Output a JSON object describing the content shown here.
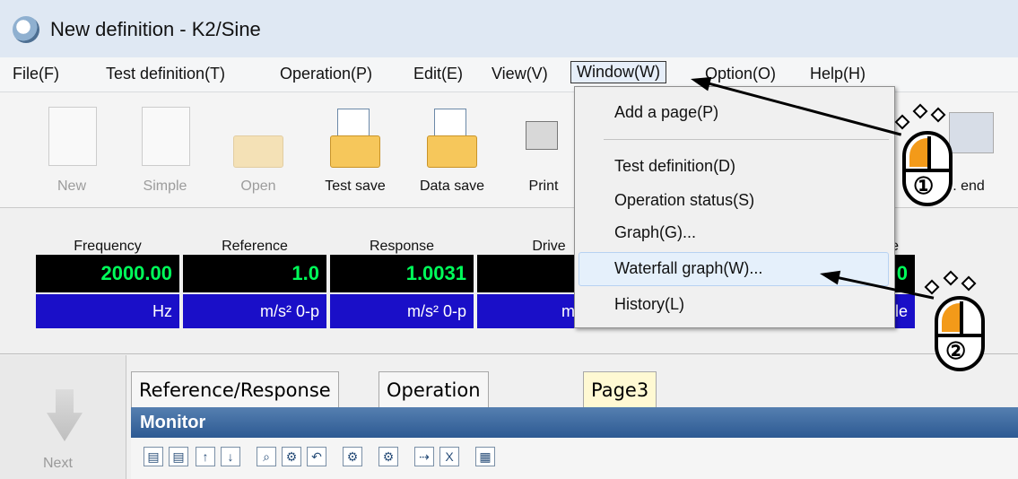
{
  "window": {
    "title": "New definition - K2/Sine"
  },
  "menu": [
    "File(F)",
    "Test definition(T)",
    "Operation(P)",
    "Edit(E)",
    "View(V)",
    "Window(W)",
    "Option(O)",
    "Help(H)"
  ],
  "toolbar": [
    "New",
    "Simple",
    "Open",
    "Test save",
    "Data save",
    "Print",
    ". end"
  ],
  "status": {
    "items": [
      {
        "label": "Frequency",
        "value": "2000.00",
        "unit": "Hz"
      },
      {
        "label": "Reference",
        "value": "1.0",
        "unit": "m/s² 0-p"
      },
      {
        "label": "Response",
        "value": "1.0031",
        "unit": "m/s² 0-p"
      },
      {
        "label": "Drive",
        "value": "5",
        "unit": "mV 0-p"
      },
      {
        "label": "e",
        "value": "0",
        "unit": "cycle"
      }
    ]
  },
  "window_menu": [
    "Add a page(P)",
    "Test definition(D)",
    "Operation status(S)",
    "Graph(G)...",
    "Waterfall graph(W)...",
    "History(L)"
  ],
  "tabs": [
    "Reference/Response",
    "Operation status",
    "Page3"
  ],
  "panel": {
    "title": "Monitor"
  },
  "left": {
    "next_label": "Next"
  },
  "callouts": [
    "①",
    "②"
  ]
}
